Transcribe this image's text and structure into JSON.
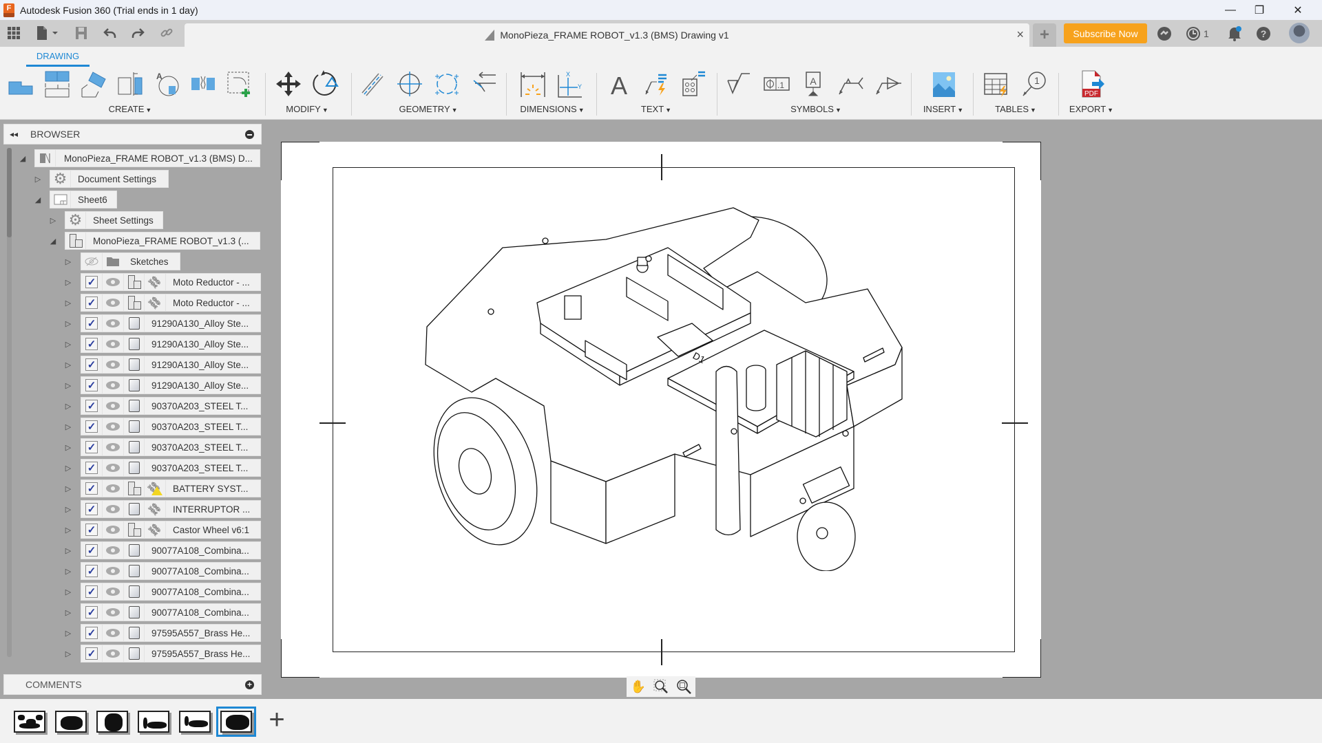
{
  "window": {
    "app_title": "Autodesk Fusion 360 (Trial ends in 1 day)",
    "app_icon": "fusion-logo-icon",
    "controls": [
      "minimize",
      "restore",
      "close"
    ]
  },
  "quick_access": {
    "icons": [
      "app-grid-icon",
      "file-icon",
      "save-icon",
      "undo-icon",
      "redo-icon",
      "link-icon"
    ]
  },
  "document_tab": {
    "title": "MonoPieza_FRAME ROBOT_v1.3 (BMS) Drawing v1",
    "close": "×"
  },
  "header_right": {
    "new_tab": "+",
    "subscribe_label": "Subscribe Now",
    "subscribe_color": "#f7a21c",
    "job_status_count": "1",
    "icons": [
      "extensions-icon",
      "job-status-icon",
      "notifications-icon",
      "help-icon",
      "user-avatar"
    ]
  },
  "ribbon": {
    "active_tab": "DRAWING",
    "accent_color": "#1e88d4",
    "groups": [
      {
        "label": "CREATE",
        "tools": [
          "base-view",
          "projected-view",
          "section-view",
          "detail-view",
          "auxiliary-view",
          "break-view",
          "sketch"
        ]
      },
      {
        "label": "MODIFY",
        "tools": [
          "move",
          "rotate"
        ]
      },
      {
        "label": "GEOMETRY",
        "tools": [
          "centerline",
          "center-mark",
          "center-mark-pattern",
          "edge-extension"
        ]
      },
      {
        "label": "DIMENSIONS",
        "tools": [
          "dimension",
          "ordinate-dimension"
        ]
      },
      {
        "label": "TEXT",
        "tools": [
          "text",
          "leader",
          "hole-note"
        ]
      },
      {
        "label": "SYMBOLS",
        "tools": [
          "surface-texture",
          "feature-control-frame",
          "datum-identifier",
          "welding",
          "taper-slope"
        ]
      },
      {
        "label": "INSERT",
        "tools": [
          "insert-image"
        ]
      },
      {
        "label": "TABLES",
        "tools": [
          "table",
          "balloon"
        ]
      },
      {
        "label": "EXPORT",
        "tools": [
          "export-pdf"
        ]
      }
    ]
  },
  "browser": {
    "title": "BROWSER",
    "root": "MonoPieza_FRAME ROBOT_v1.3 (BMS) D...",
    "document_settings": "Document Settings",
    "sheet": "Sheet6",
    "sheet_settings": "Sheet Settings",
    "view": "MonoPieza_FRAME ROBOT_v1.3 (...",
    "sketches": "Sketches",
    "items": [
      {
        "name": "Moto Reductor - ...",
        "type": "component",
        "link": true,
        "warning": false
      },
      {
        "name": "Moto Reductor - ...",
        "type": "component",
        "link": true,
        "warning": false
      },
      {
        "name": "91290A130_Alloy Ste...",
        "type": "body",
        "link": false,
        "warning": false
      },
      {
        "name": "91290A130_Alloy Ste...",
        "type": "body",
        "link": false,
        "warning": false
      },
      {
        "name": "91290A130_Alloy Ste...",
        "type": "body",
        "link": false,
        "warning": false
      },
      {
        "name": "91290A130_Alloy Ste...",
        "type": "body",
        "link": false,
        "warning": false
      },
      {
        "name": "90370A203_STEEL T...",
        "type": "body",
        "link": false,
        "warning": false
      },
      {
        "name": "90370A203_STEEL T...",
        "type": "body",
        "link": false,
        "warning": false
      },
      {
        "name": "90370A203_STEEL T...",
        "type": "body",
        "link": false,
        "warning": false
      },
      {
        "name": "90370A203_STEEL T...",
        "type": "body",
        "link": false,
        "warning": false
      },
      {
        "name": "BATTERY SYST...",
        "type": "component",
        "link": true,
        "warning": true
      },
      {
        "name": "INTERRUPTOR ...",
        "type": "body",
        "link": true,
        "warning": false
      },
      {
        "name": "Castor Wheel v6:1",
        "type": "component",
        "link": true,
        "warning": false
      },
      {
        "name": "90077A108_Combina...",
        "type": "body",
        "link": false,
        "warning": false
      },
      {
        "name": "90077A108_Combina...",
        "type": "body",
        "link": false,
        "warning": false
      },
      {
        "name": "90077A108_Combina...",
        "type": "body",
        "link": false,
        "warning": false
      },
      {
        "name": "90077A108_Combina...",
        "type": "body",
        "link": false,
        "warning": false
      },
      {
        "name": "97595A557_Brass He...",
        "type": "body",
        "link": false,
        "warning": false
      },
      {
        "name": "97595A557_Brass He...",
        "type": "body",
        "link": false,
        "warning": false
      }
    ]
  },
  "comments": {
    "title": "COMMENTS"
  },
  "navigation_bar": {
    "tools": [
      "pan-icon",
      "zoom-window-icon",
      "zoom-fit-icon"
    ]
  },
  "sheets": {
    "count": 6,
    "active_index": 5,
    "add_label": "+"
  },
  "drawing": {
    "view": "isometric robot chassis assembly",
    "board_marking": "D1"
  }
}
